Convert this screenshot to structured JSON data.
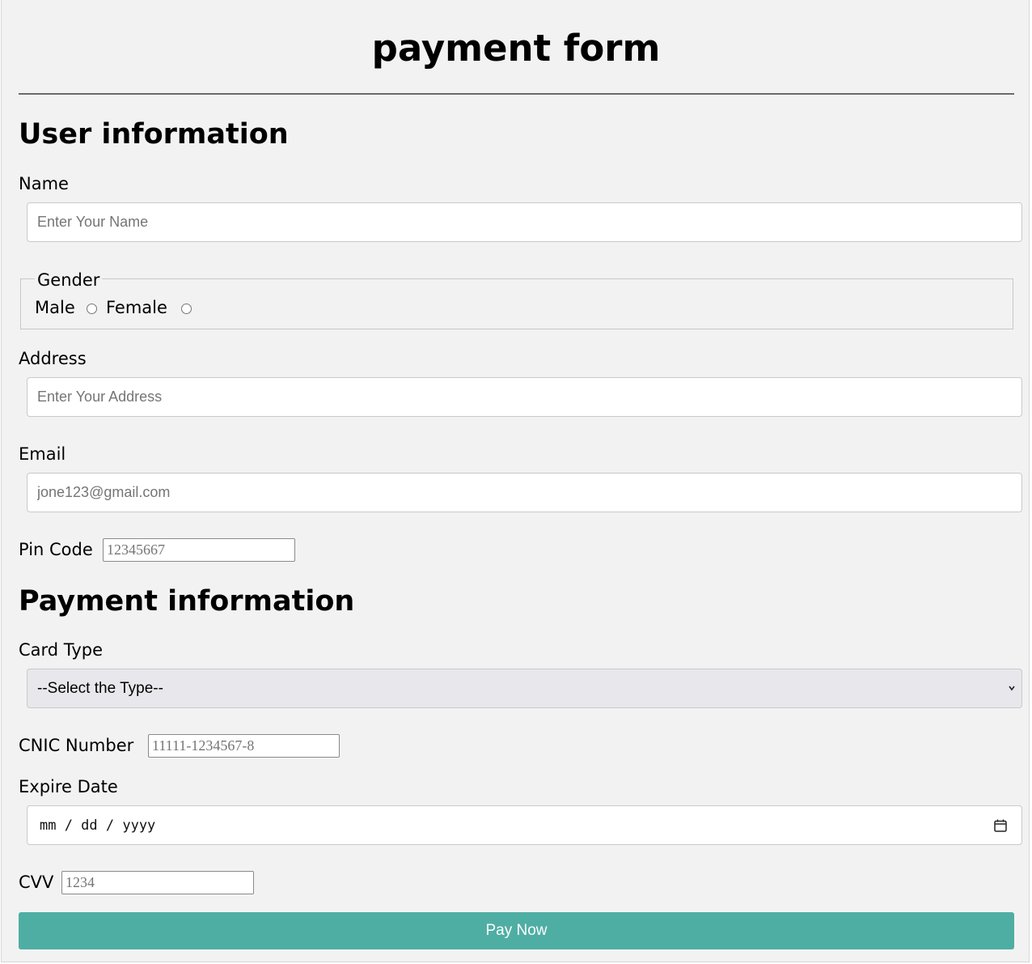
{
  "form": {
    "title": "payment form"
  },
  "user_info": {
    "heading": "User information",
    "name": {
      "label": "Name",
      "placeholder": "Enter Your Name",
      "value": ""
    },
    "gender": {
      "legend": "Gender",
      "options": [
        {
          "label": "Male",
          "checked": false
        },
        {
          "label": "Female",
          "checked": false
        }
      ]
    },
    "address": {
      "label": "Address",
      "placeholder": "Enter Your Address",
      "value": ""
    },
    "email": {
      "label": "Email",
      "placeholder": "jone123@gmail.com",
      "value": ""
    },
    "pin_code": {
      "label": "Pin Code",
      "placeholder": "12345667",
      "value": ""
    }
  },
  "payment_info": {
    "heading": "Payment information",
    "card_type": {
      "label": "Card Type",
      "selected": "--Select the Type--"
    },
    "cnic": {
      "label": "CNIC Number",
      "placeholder": "11111-1234567-8",
      "value": ""
    },
    "expire_date": {
      "label": "Expire Date",
      "format_placeholder": "mm / dd / yyyy"
    },
    "cvv": {
      "label": "CVV",
      "placeholder": "1234",
      "value": ""
    }
  },
  "submit": {
    "label": "Pay Now"
  },
  "colors": {
    "page_background": "#f2f2f2",
    "button_background": "#4faea4",
    "button_text": "#ffffff",
    "select_background": "#e8e8ec"
  },
  "icons": {
    "select_arrow": "chevron-down-icon",
    "date_picker": "calendar-icon"
  }
}
